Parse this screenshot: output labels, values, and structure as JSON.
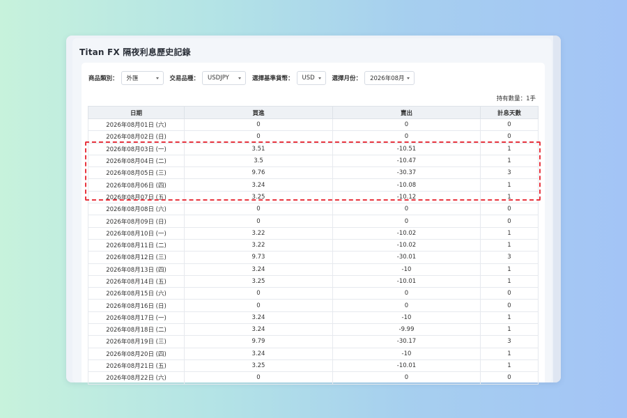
{
  "page": {
    "title": "Titan FX 隔夜利息歷史記錄"
  },
  "filters": {
    "category": {
      "label": "商品類別：",
      "value": "外匯"
    },
    "instrument": {
      "label": "交易品種：",
      "value": "USDJPY"
    },
    "base_currency": {
      "label": "選擇基準貨幣：",
      "value": "USD"
    },
    "month": {
      "label": "選擇月份：",
      "value": "2026年08月"
    }
  },
  "hold_count": "持有數量：1手",
  "table": {
    "headers": [
      "日期",
      "買進",
      "賣出",
      "計息天數"
    ],
    "rows": [
      [
        "2026年08月01日 (六)",
        "0",
        "0",
        "0"
      ],
      [
        "2026年08月02日 (日)",
        "0",
        "0",
        "0"
      ],
      [
        "2026年08月03日 (一)",
        "3.51",
        "-10.51",
        "1"
      ],
      [
        "2026年08月04日 (二)",
        "3.5",
        "-10.47",
        "1"
      ],
      [
        "2026年08月05日 (三)",
        "9.76",
        "-30.37",
        "3"
      ],
      [
        "2026年08月06日 (四)",
        "3.24",
        "-10.08",
        "1"
      ],
      [
        "2026年08月07日 (五)",
        "3.25",
        "-10.12",
        "1"
      ],
      [
        "2026年08月08日 (六)",
        "0",
        "0",
        "0"
      ],
      [
        "2026年08月09日 (日)",
        "0",
        "0",
        "0"
      ],
      [
        "2026年08月10日 (一)",
        "3.22",
        "-10.02",
        "1"
      ],
      [
        "2026年08月11日 (二)",
        "3.22",
        "-10.02",
        "1"
      ],
      [
        "2026年08月12日 (三)",
        "9.73",
        "-30.01",
        "3"
      ],
      [
        "2026年08月13日 (四)",
        "3.24",
        "-10",
        "1"
      ],
      [
        "2026年08月14日 (五)",
        "3.25",
        "-10.01",
        "1"
      ],
      [
        "2026年08月15日 (六)",
        "0",
        "0",
        "0"
      ],
      [
        "2026年08月16日 (日)",
        "0",
        "0",
        "0"
      ],
      [
        "2026年08月17日 (一)",
        "3.24",
        "-10",
        "1"
      ],
      [
        "2026年08月18日 (二)",
        "3.24",
        "-9.99",
        "1"
      ],
      [
        "2026年08月19日 (三)",
        "9.79",
        "-30.17",
        "3"
      ],
      [
        "2026年08月20日 (四)",
        "3.24",
        "-10",
        "1"
      ],
      [
        "2026年08月21日 (五)",
        "3.25",
        "-10.01",
        "1"
      ],
      [
        "2026年08月22日 (六)",
        "0",
        "0",
        "0"
      ]
    ]
  },
  "highlight_color": "#e8343e"
}
